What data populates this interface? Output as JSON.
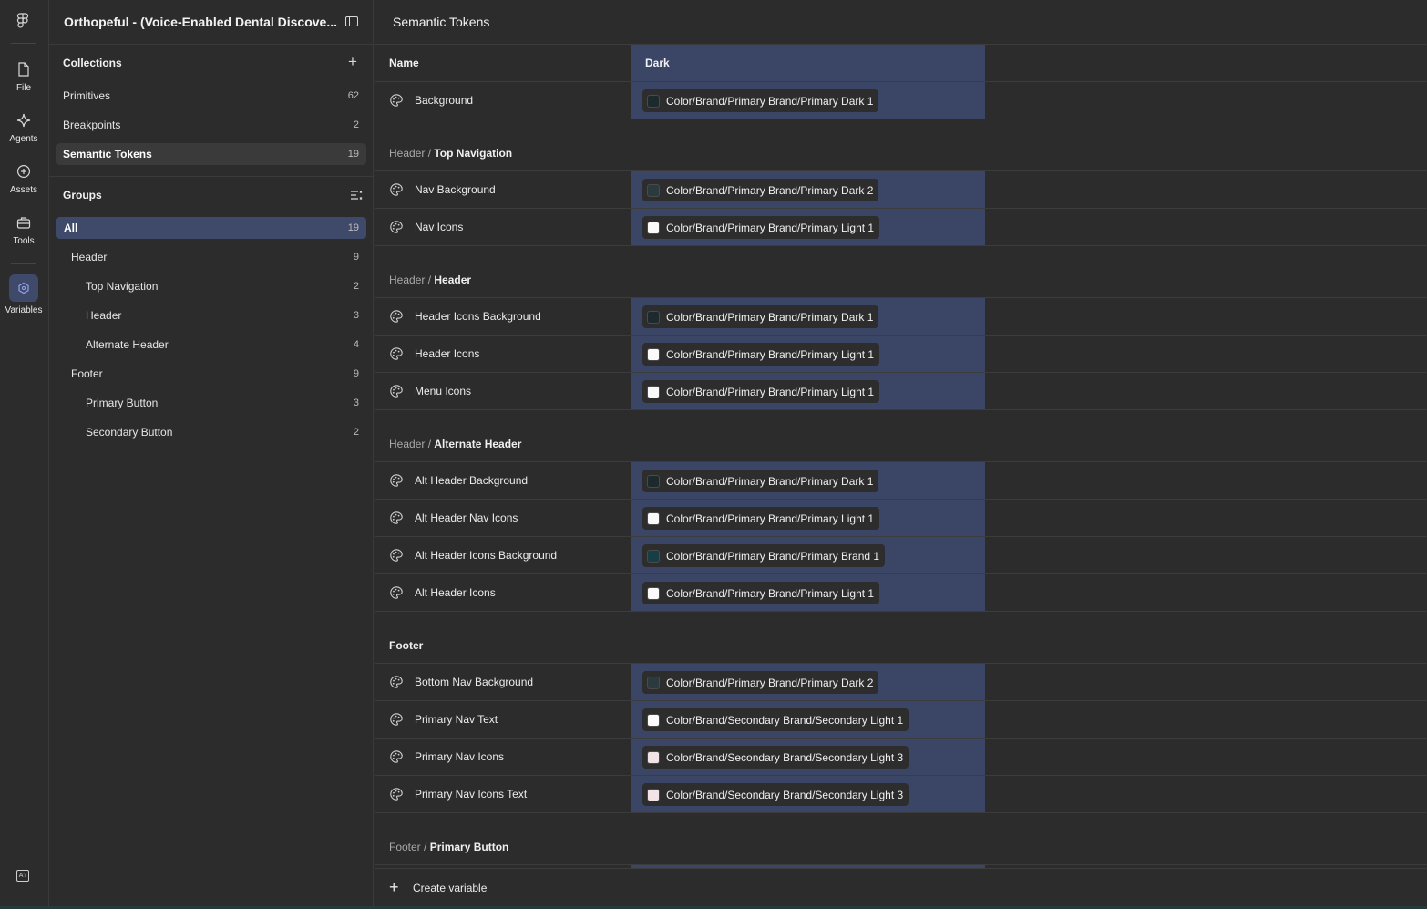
{
  "rail": {
    "items": [
      {
        "label": "File",
        "icon": "file-icon"
      },
      {
        "label": "Agents",
        "icon": "sparkle-icon"
      },
      {
        "label": "Assets",
        "icon": "plus-circle-icon"
      },
      {
        "label": "Tools",
        "icon": "toolbox-icon"
      },
      {
        "label": "Variables",
        "icon": "variables-icon",
        "active": true
      }
    ],
    "bottom_badge": "A?"
  },
  "sidebar": {
    "title": "Orthopeful - (Voice-Enabled Dental Discove...",
    "collections_heading": "Collections",
    "collections": [
      {
        "name": "Primitives",
        "count": "62"
      },
      {
        "name": "Breakpoints",
        "count": "2"
      },
      {
        "name": "Semantic Tokens",
        "count": "19"
      }
    ],
    "groups_heading": "Groups",
    "groups": [
      {
        "name": "All",
        "count": "19"
      },
      {
        "name": "Header",
        "count": "9"
      },
      {
        "name": "Top Navigation",
        "count": "2"
      },
      {
        "name": "Header",
        "count": "3"
      },
      {
        "name": "Alternate Header",
        "count": "4"
      },
      {
        "name": "Footer",
        "count": "9"
      },
      {
        "name": "Primary Button",
        "count": "3"
      },
      {
        "name": "Secondary Button",
        "count": "2"
      }
    ]
  },
  "main": {
    "title": "Semantic Tokens",
    "col_name": "Name",
    "col_mode": "Dark",
    "create_label": "Create variable",
    "colors": {
      "dark1": "#1c2a2e",
      "dark2": "#2b3a3e",
      "light1": "#fafafa",
      "brand1": "#163e44",
      "secondaryLight1": "#fdfbfb",
      "secondaryLight3": "#f1e3e6",
      "mode_column": "#3b4565",
      "selected_group": "#3f4a6b"
    },
    "groups": [
      {
        "prefix": "",
        "name": "",
        "rows": [
          {
            "name": "Background",
            "value": "Color/Brand/Primary Brand/Primary Dark 1",
            "swatch": "dark1"
          }
        ]
      },
      {
        "prefix": "Header / ",
        "name": "Top Navigation",
        "rows": [
          {
            "name": "Nav Background",
            "value": "Color/Brand/Primary Brand/Primary Dark 2",
            "swatch": "dark2"
          },
          {
            "name": "Nav Icons",
            "value": "Color/Brand/Primary Brand/Primary Light 1",
            "swatch": "light1"
          }
        ]
      },
      {
        "prefix": "Header / ",
        "name": "Header",
        "rows": [
          {
            "name": "Header Icons Background",
            "value": "Color/Brand/Primary Brand/Primary Dark 1",
            "swatch": "dark1"
          },
          {
            "name": "Header Icons",
            "value": "Color/Brand/Primary Brand/Primary Light 1",
            "swatch": "light1"
          },
          {
            "name": "Menu Icons",
            "value": "Color/Brand/Primary Brand/Primary Light 1",
            "swatch": "light1"
          }
        ]
      },
      {
        "prefix": "Header / ",
        "name": "Alternate Header",
        "rows": [
          {
            "name": "Alt Header Background",
            "value": "Color/Brand/Primary Brand/Primary Dark 1",
            "swatch": "dark1"
          },
          {
            "name": "Alt Header Nav Icons",
            "value": "Color/Brand/Primary Brand/Primary Light 1",
            "swatch": "light1"
          },
          {
            "name": "Alt Header Icons Background",
            "value": "Color/Brand/Primary Brand/Primary Brand 1",
            "swatch": "brand1"
          },
          {
            "name": "Alt Header Icons",
            "value": "Color/Brand/Primary Brand/Primary Light 1",
            "swatch": "light1"
          }
        ]
      },
      {
        "prefix": "",
        "name": "Footer",
        "rows": [
          {
            "name": "Bottom Nav Background",
            "value": "Color/Brand/Primary Brand/Primary Dark 2",
            "swatch": "dark2"
          },
          {
            "name": "Primary Nav Text",
            "value": "Color/Brand/Secondary Brand/Secondary Light 1",
            "swatch": "secondaryLight1"
          },
          {
            "name": "Primary Nav Icons",
            "value": "Color/Brand/Secondary Brand/Secondary Light 3",
            "swatch": "secondaryLight3"
          },
          {
            "name": "Primary Nav Icons Text",
            "value": "Color/Brand/Secondary Brand/Secondary Light 3",
            "swatch": "secondaryLight3"
          }
        ]
      },
      {
        "prefix": "Footer / ",
        "name": "Primary Button",
        "rows": []
      }
    ]
  }
}
